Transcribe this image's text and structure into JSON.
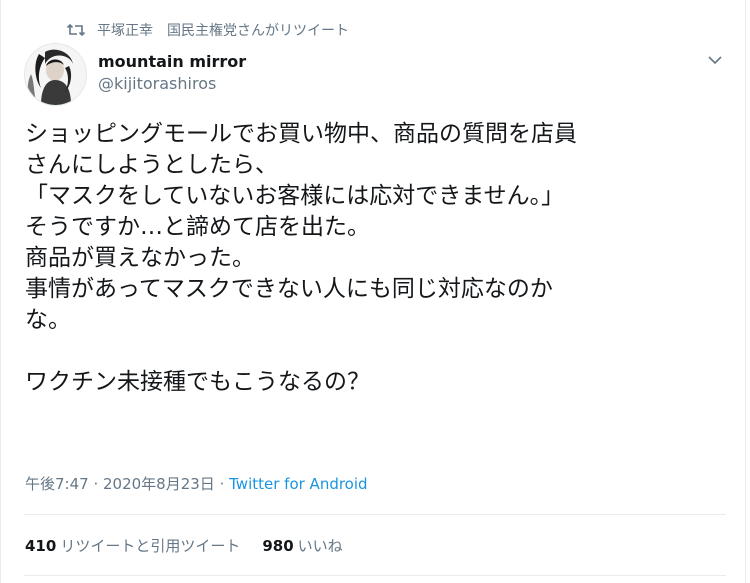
{
  "retweet_context": {
    "icon": "retweet-icon",
    "retweeter": "平塚正幸",
    "label": "国民主権党さんがリツイート"
  },
  "author": {
    "display_name": "mountain mirror",
    "handle": "@kijitorashiros"
  },
  "tweet": {
    "lines": [
      "ショッピングモールでお買い物中、商品の質問を店員",
      "さんにしようとしたら、",
      "「マスクをしていないお客様には応対できません。」",
      "そうですか…と諦めて店を出た。",
      "商品が買えなかった。",
      "事情があってマスクできない人にも同じ対応なのか",
      "な。",
      "",
      "ワクチン未接種でもこうなるの？"
    ]
  },
  "meta": {
    "time": "午後7:47",
    "separator": " · ",
    "date": "2020年8月23日",
    "source": "Twitter for Android"
  },
  "stats": {
    "retweets_count": "410",
    "retweets_label": "リツイートと引用ツイート",
    "likes_count": "980",
    "likes_label": "いいね"
  },
  "colors": {
    "text": "#14171a",
    "secondary": "#657786",
    "link": "#1b95e0",
    "divider": "#e6ecf0"
  }
}
